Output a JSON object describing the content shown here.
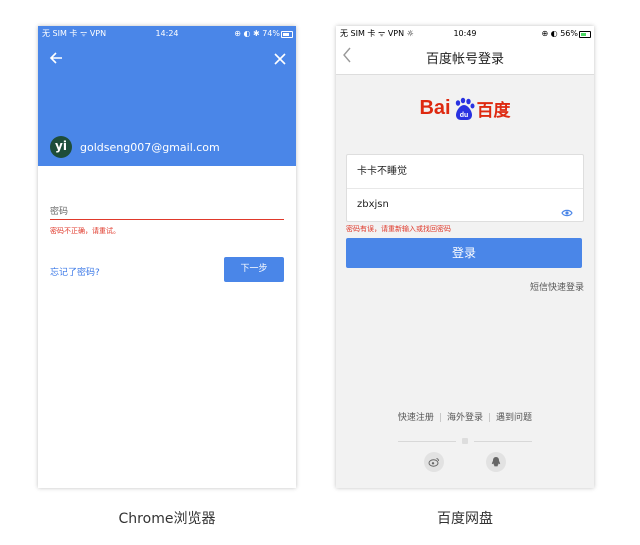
{
  "captions": {
    "left": "Chrome浏览器",
    "right": "百度网盘"
  },
  "chrome": {
    "status": {
      "carrier": "无 SIM 卡 ᯤ VPN",
      "time": "14:24",
      "right": "⊕ ◐ ✱ 74%"
    },
    "avatar_letter": "yi",
    "email": "goldseng007@gmail.com",
    "password_label": "密码",
    "error_text": "密码不正确，请重试。",
    "forgot_link": "忘记了密码?",
    "next_button": "下一步",
    "colors": {
      "accent": "#4a86e8",
      "error": "#e0392b"
    }
  },
  "baidu": {
    "status": {
      "carrier": "无 SIM 卡 ᯤ VPN ☼",
      "time": "10:49",
      "right": "⊕ ◐ 56%"
    },
    "nav_title": "百度帐号登录",
    "logo_text_en": "Bai",
    "logo_text_cn": "百度",
    "logo_du": "du",
    "username_value": "卡卡不睡觉",
    "password_value": "zbxjsn",
    "error_text": "密码有误，请重新输入或找回密码",
    "login_button": "登录",
    "sms_login": "短信快速登录",
    "footer": {
      "register": "快速注册",
      "overseas": "海外登录",
      "problem": "遇到问题",
      "separator": "|"
    },
    "colors": {
      "accent": "#4a86e8",
      "logo_red": "#de2910",
      "error": "#e0392b"
    }
  }
}
